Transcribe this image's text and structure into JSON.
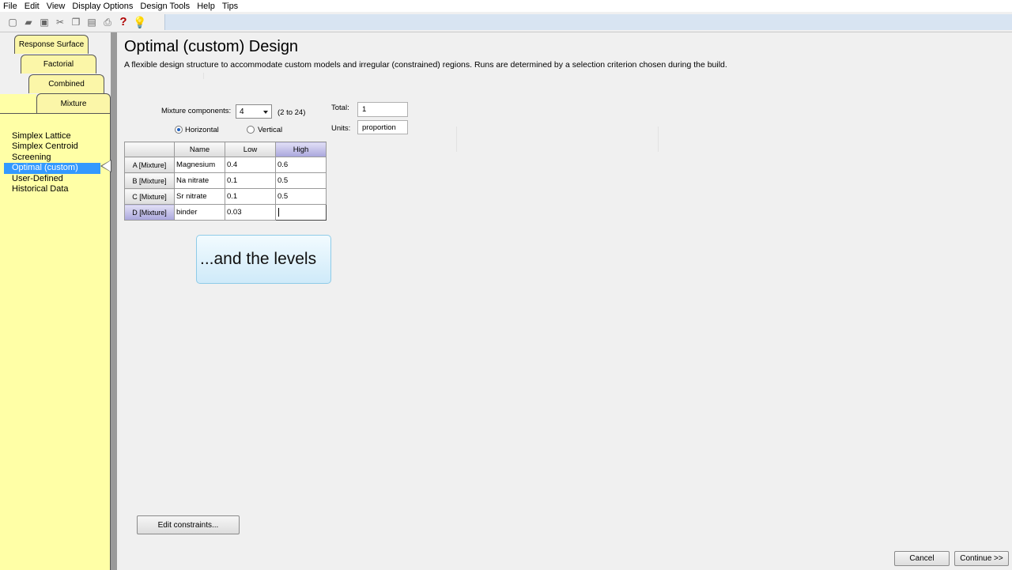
{
  "menu": [
    "File",
    "Edit",
    "View",
    "Display Options",
    "Design Tools",
    "Help",
    "Tips"
  ],
  "toolbar": {
    "icons": [
      "new-icon",
      "open-icon",
      "save-icon",
      "cut-icon",
      "copy-icon",
      "paste-icon",
      "print-icon",
      "help-icon",
      "tip-bulb-icon"
    ],
    "help_glyph": "?",
    "tip_glyph": "💡"
  },
  "tabs": {
    "response_surface": "Response Surface",
    "factorial": "Factorial",
    "combined": "Combined",
    "mixture": "Mixture"
  },
  "design_list": [
    "Simplex Lattice",
    "Simplex Centroid",
    "Screening",
    "Optimal (custom)",
    "User-Defined",
    "Historical Data"
  ],
  "selected_design": "Optimal (custom)",
  "page": {
    "title": "Optimal (custom) Design",
    "description": "A flexible design structure to accommodate custom models and irregular (constrained) regions.  Runs are determined by a selection criterion chosen during the build."
  },
  "form": {
    "components_label": "Mixture components:",
    "components_value": "4",
    "components_range": "(2 to 24)",
    "total_label": "Total:",
    "total_value": "1",
    "units_label": "Units:",
    "units_value": "proportion",
    "horizontal_label": "Horizontal",
    "vertical_label": "Vertical"
  },
  "grid": {
    "columns": [
      "Name",
      "Low",
      "High"
    ],
    "rows": [
      {
        "id": "A [Mixture]",
        "name": "Magnesium",
        "low": "0.4",
        "high": "0.6"
      },
      {
        "id": "B [Mixture]",
        "name": "Na nitrate",
        "low": "0.1",
        "high": "0.5"
      },
      {
        "id": "C [Mixture]",
        "name": "Sr nitrate",
        "low": "0.1",
        "high": "0.5"
      },
      {
        "id": "D [Mixture]",
        "name": "binder",
        "low": "0.03",
        "high": ""
      }
    ]
  },
  "callout": "...and the levels",
  "buttons": {
    "edit_constraints": "Edit constraints...",
    "cancel": "Cancel",
    "continue": "Continue >>"
  }
}
